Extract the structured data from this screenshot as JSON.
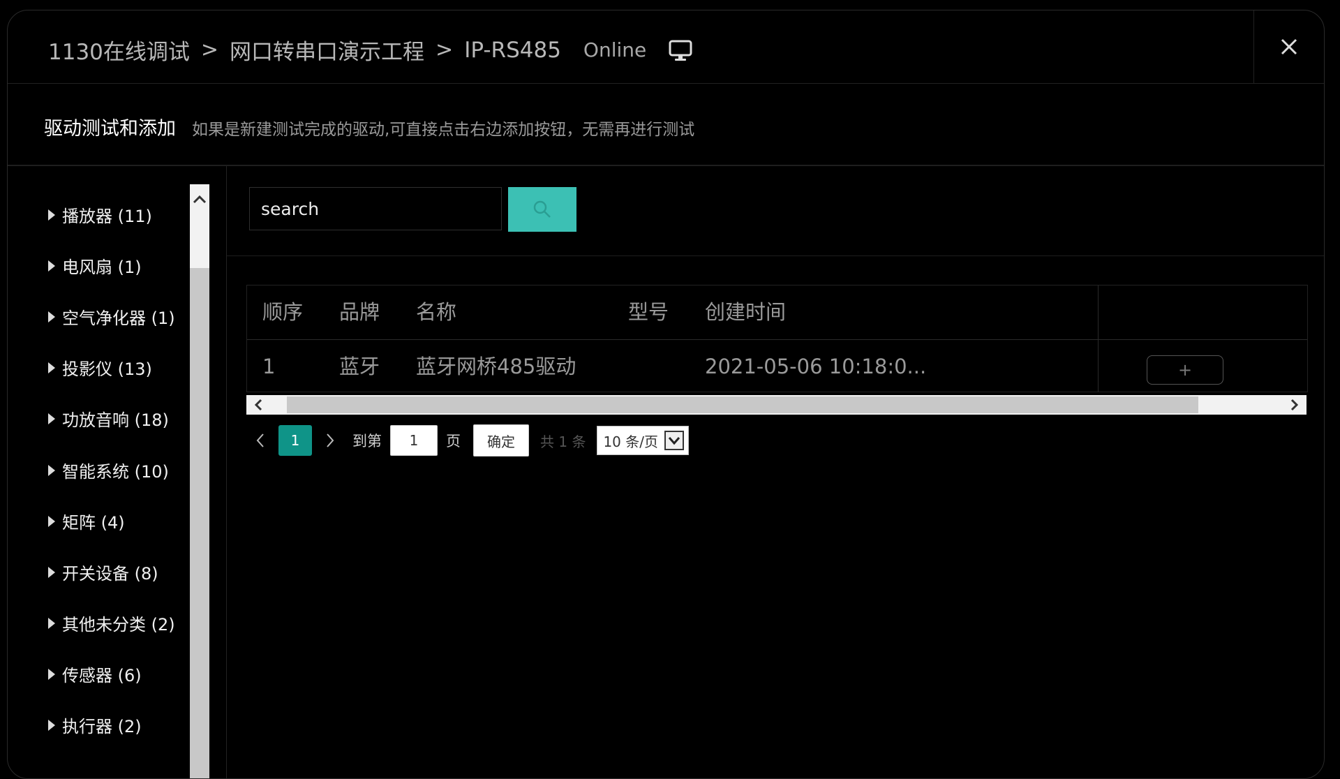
{
  "header": {
    "breadcrumbs": [
      "1130在线调试",
      "网口转串口演示工程",
      "IP-RS485"
    ],
    "status": "Online",
    "monitor_icon": "monitor-icon",
    "close_icon": "close-icon"
  },
  "subheader": {
    "title": "驱动测试和添加",
    "hint": "如果是新建测试完成的驱动,可直接点击右边添加按钮，无需再进行测试"
  },
  "sidebar": {
    "categories": [
      {
        "label": "播放器 (11)"
      },
      {
        "label": "电风扇 (1)"
      },
      {
        "label": "空气净化器 (1)"
      },
      {
        "label": "投影仪 (13)"
      },
      {
        "label": "功放音响 (18)"
      },
      {
        "label": "智能系统 (10)"
      },
      {
        "label": "矩阵 (4)"
      },
      {
        "label": "开关设备 (8)"
      },
      {
        "label": "其他未分类 (2)"
      },
      {
        "label": "传感器 (6)"
      },
      {
        "label": "执行器 (2)"
      }
    ]
  },
  "search": {
    "placeholder": "search",
    "button_icon": "search-icon",
    "accent": "#3cc0b4"
  },
  "table": {
    "headers": [
      "顺序",
      "品牌",
      "名称",
      "型号",
      "创建时间"
    ],
    "rows": [
      {
        "index": "1",
        "brand": "蓝牙",
        "name": "蓝牙网桥485驱动",
        "model": "",
        "created": "2021-05-06 10:18:0...",
        "action": "+"
      }
    ]
  },
  "pagination": {
    "current_page": "1",
    "goto_label": "到第",
    "goto_value": "1",
    "page_label": "页",
    "confirm_label": "确定",
    "total_label": "共 1 条",
    "page_size": "10 条/页",
    "active_color": "#0f9488"
  }
}
